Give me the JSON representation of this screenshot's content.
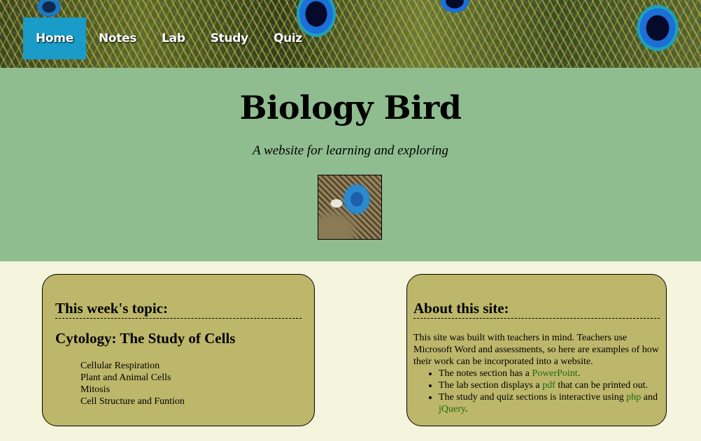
{
  "nav": {
    "items": [
      "Home",
      "Notes",
      "Lab",
      "Study",
      "Quiz"
    ],
    "active": "Home"
  },
  "hero": {
    "title": "Biology Bird",
    "tagline": "A website for learning and exploring"
  },
  "topic": {
    "heading": "This week's topic:",
    "subject": "Cytology: The Study of Cells",
    "items": [
      "Cellular Respiration",
      "Plant and Animal Cells",
      "Mitosis",
      "Cell Structure and Funtion"
    ]
  },
  "about": {
    "heading": "About this site:",
    "intro": "This site was built with teachers in mind. Teachers use Microsoft Word and assessments, so here are examples of how their work can be incorporated into a website.",
    "bullets": [
      {
        "before": "The notes section has a ",
        "link": "PowerPoint",
        "after": "."
      },
      {
        "before": "The lab section displays a ",
        "link": "pdf",
        "after": " that can be printed out."
      },
      {
        "before": "The study and quiz sections is interactive using ",
        "link": "php",
        "middle": " and ",
        "link2": "jQuery",
        "after": "."
      }
    ]
  },
  "colors": {
    "nav_active": "#1a9cc8",
    "hero_bg": "#8fbd8f",
    "box_bg": "#bdb76b",
    "link": "#1d6b0b",
    "page_bg": "#f5f4dc"
  }
}
